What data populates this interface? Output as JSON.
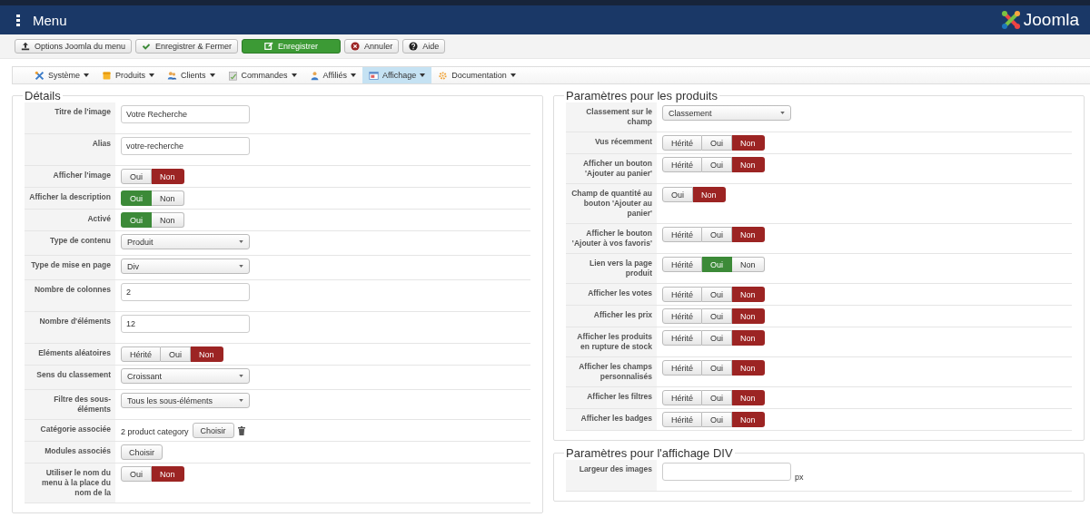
{
  "header": {
    "title": "Menu",
    "logo_text": "Joomla"
  },
  "toolbar": [
    {
      "label": "Options Joomla du menu",
      "kind": "upload",
      "primary": false
    },
    {
      "label": "Enregistrer & Fermer",
      "kind": "check",
      "primary": false
    },
    {
      "label": "Enregistrer",
      "kind": "edit",
      "primary": true
    },
    {
      "label": "Annuler",
      "kind": "cancel",
      "primary": false
    },
    {
      "label": "Aide",
      "kind": "help",
      "primary": false
    }
  ],
  "submenu": [
    {
      "label": "Système",
      "kind": "tools",
      "selected": false
    },
    {
      "label": "Produits",
      "kind": "box",
      "selected": false
    },
    {
      "label": "Clients",
      "kind": "users",
      "selected": false
    },
    {
      "label": "Commandes",
      "kind": "clipboard",
      "selected": false
    },
    {
      "label": "Affiliés",
      "kind": "user",
      "selected": false
    },
    {
      "label": "Affichage",
      "kind": "window",
      "selected": true
    },
    {
      "label": "Documentation",
      "kind": "cog",
      "selected": false
    }
  ],
  "columns": [
    [
      {
        "title": "Détails",
        "rows": [
          {
            "label": "Titre de l'image",
            "kind": "text",
            "value": "Votre Recherche"
          },
          {
            "label": "Alias",
            "kind": "text",
            "value": "votre-recherche"
          },
          {
            "label": "Afficher l'image",
            "kind": "toggle",
            "options": [
              {
                "label": "Oui",
                "selected": false
              },
              {
                "label": "Non",
                "selected": true,
                "color": "#9c2423"
              }
            ]
          },
          {
            "label": "Afficher la description",
            "kind": "toggle",
            "options": [
              {
                "label": "Oui",
                "selected": true,
                "color": "#3c8a38"
              },
              {
                "label": "Non",
                "selected": false
              }
            ]
          },
          {
            "label": "Activé",
            "kind": "toggle",
            "options": [
              {
                "label": "Oui",
                "selected": true,
                "color": "#3c8a38"
              },
              {
                "label": "Non",
                "selected": false
              }
            ]
          },
          {
            "label": "Type de contenu",
            "kind": "select",
            "value": "Produit"
          },
          {
            "label": "Type de mise en page",
            "kind": "select",
            "value": "Div"
          },
          {
            "label": "Nombre de colonnes",
            "kind": "text",
            "value": "2"
          },
          {
            "label": "Nombre d'éléments",
            "kind": "text",
            "value": "12"
          },
          {
            "label": "Eléments aléatoires",
            "kind": "toggle",
            "options": [
              {
                "label": "Hérité",
                "selected": false
              },
              {
                "label": "Oui",
                "selected": false
              },
              {
                "label": "Non",
                "selected": true,
                "color": "#9c2423"
              }
            ]
          },
          {
            "label": "Sens du classement",
            "kind": "select",
            "value": "Croissant"
          },
          {
            "label": "Filtre des sous-éléments",
            "kind": "select",
            "value": "Tous les sous-éléments"
          },
          {
            "label": "Catégorie associée",
            "kind": "chooser",
            "value": "2 product category",
            "button": "Choisir"
          },
          {
            "label": "Modules associés",
            "kind": "button",
            "button": "Choisir"
          },
          {
            "label": "Utiliser le nom du menu à la place du nom de la",
            "kind": "toggle",
            "options": [
              {
                "label": "Oui",
                "selected": false
              },
              {
                "label": "Non",
                "selected": true,
                "color": "#9c2423"
              }
            ]
          }
        ]
      }
    ],
    [
      {
        "title": "Paramètres pour les produits",
        "rows": [
          {
            "label": "Classement sur le champ",
            "kind": "select",
            "value": "Classement"
          },
          {
            "label": "Vus récemment",
            "kind": "toggle",
            "options": [
              {
                "label": "Hérité",
                "selected": false
              },
              {
                "label": "Oui",
                "selected": false
              },
              {
                "label": "Non",
                "selected": true,
                "color": "#9c2423"
              }
            ]
          },
          {
            "label": "Afficher un bouton 'Ajouter au panier'",
            "kind": "toggle",
            "options": [
              {
                "label": "Hérité",
                "selected": false
              },
              {
                "label": "Oui",
                "selected": false
              },
              {
                "label": "Non",
                "selected": true,
                "color": "#9c2423"
              }
            ]
          },
          {
            "label": "Champ de quantité au bouton 'Ajouter au panier'",
            "kind": "toggle",
            "options": [
              {
                "label": "Oui",
                "selected": false
              },
              {
                "label": "Non",
                "selected": true,
                "color": "#9c2423"
              }
            ]
          },
          {
            "label": "Afficher le bouton 'Ajouter à vos favoris'",
            "kind": "toggle",
            "options": [
              {
                "label": "Hérité",
                "selected": false
              },
              {
                "label": "Oui",
                "selected": false
              },
              {
                "label": "Non",
                "selected": true,
                "color": "#9c2423"
              }
            ]
          },
          {
            "label": "Lien vers la page produit",
            "kind": "toggle",
            "options": [
              {
                "label": "Hérité",
                "selected": false
              },
              {
                "label": "Oui",
                "selected": true,
                "color": "#3c8a38"
              },
              {
                "label": "Non",
                "selected": false
              }
            ]
          },
          {
            "label": "Afficher les votes",
            "kind": "toggle",
            "options": [
              {
                "label": "Hérité",
                "selected": false
              },
              {
                "label": "Oui",
                "selected": false
              },
              {
                "label": "Non",
                "selected": true,
                "color": "#9c2423"
              }
            ]
          },
          {
            "label": "Afficher les prix",
            "kind": "toggle",
            "options": [
              {
                "label": "Hérité",
                "selected": false
              },
              {
                "label": "Oui",
                "selected": false
              },
              {
                "label": "Non",
                "selected": true,
                "color": "#9c2423"
              }
            ]
          },
          {
            "label": "Afficher les produits en rupture de stock",
            "kind": "toggle",
            "options": [
              {
                "label": "Hérité",
                "selected": false
              },
              {
                "label": "Oui",
                "selected": false
              },
              {
                "label": "Non",
                "selected": true,
                "color": "#9c2423"
              }
            ]
          },
          {
            "label": "Afficher les champs personnalisés",
            "kind": "toggle",
            "options": [
              {
                "label": "Hérité",
                "selected": false
              },
              {
                "label": "Oui",
                "selected": false
              },
              {
                "label": "Non",
                "selected": true,
                "color": "#9c2423"
              }
            ]
          },
          {
            "label": "Afficher les filtres",
            "kind": "toggle",
            "options": [
              {
                "label": "Hérité",
                "selected": false
              },
              {
                "label": "Oui",
                "selected": false
              },
              {
                "label": "Non",
                "selected": true,
                "color": "#9c2423"
              }
            ]
          },
          {
            "label": "Afficher les badges",
            "kind": "toggle",
            "options": [
              {
                "label": "Hérité",
                "selected": false
              },
              {
                "label": "Oui",
                "selected": false
              },
              {
                "label": "Non",
                "selected": true,
                "color": "#9c2423"
              }
            ]
          }
        ]
      },
      {
        "title": "Paramètres pour l'affichage DIV",
        "rows": [
          {
            "label": "Largeur des images",
            "kind": "text",
            "value": "",
            "unit": "px"
          }
        ]
      }
    ]
  ]
}
